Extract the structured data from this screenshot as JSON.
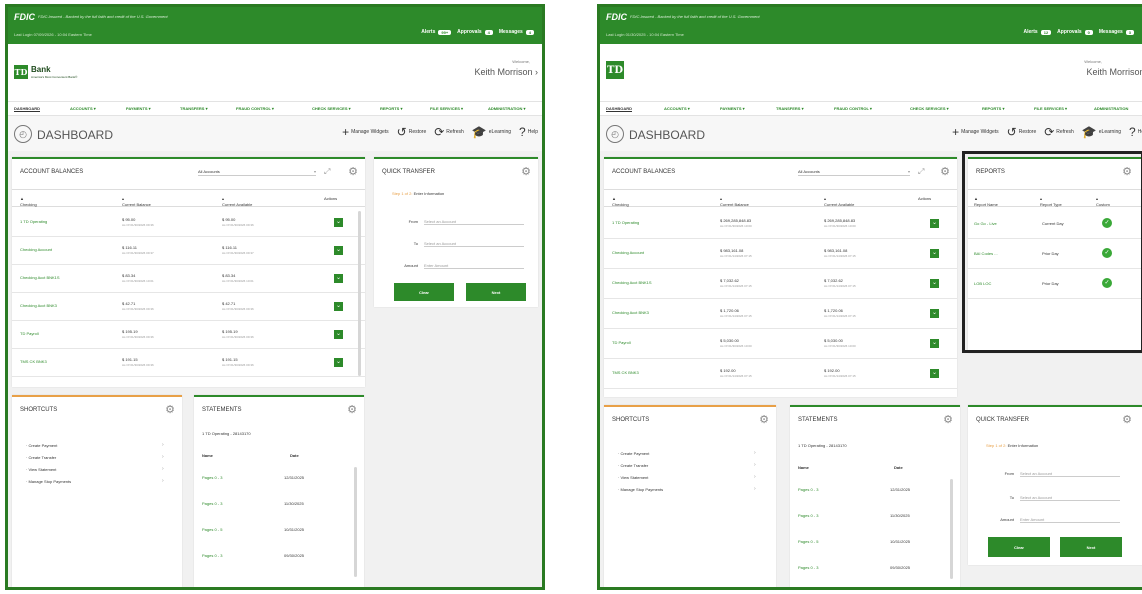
{
  "common": {
    "fdic_logo": "FDIC",
    "fdic_note": "FDIC-Insured - Backed by the full faith and credit of the U.S. Government",
    "alerts_label": "Alerts",
    "approvals_label": "Approvals",
    "messages_label": "Messages",
    "bank_logo": "TD",
    "bank_name": "Bank",
    "bank_tagline": "America's Most Convenient Bank®",
    "welcome": "Welcome,",
    "user_name": "Keith Morrison",
    "nav": [
      "DASHBOARD",
      "ACCOUNTS",
      "PAYMENTS",
      "TRANSFERS",
      "FRAUD CONTROL",
      "CHECK SERVICES",
      "REPORTS",
      "FILE SERVICES",
      "ADMINISTRATION"
    ],
    "page_title": "DASHBOARD",
    "tools": {
      "manage": "Manage Widgets",
      "restore": "Restore",
      "refresh": "Refresh",
      "elearning": "eLearning",
      "help": "Help"
    },
    "quick_transfer": {
      "title": "QUICK TRANSFER",
      "step": "Step 1 of 2:",
      "step_text": "Enter Information",
      "from_label": "From",
      "from_placeholder": "Select an Account",
      "to_label": "To",
      "to_placeholder": "Select an Account",
      "amount_label": "Amount",
      "amount_placeholder": "Enter Amount",
      "clear": "Clear",
      "next": "Next"
    },
    "shortcuts": {
      "title": "SHORTCUTS",
      "items": [
        "Create Payment",
        "Create Transfer",
        "View Statement",
        "Manage Stop Payments"
      ]
    },
    "statements": {
      "title": "STATEMENTS",
      "account": "1 TD Operating - 28143170",
      "col_name": "Name",
      "col_date": "Date",
      "rows": [
        {
          "name": "Pages 0 - 3",
          "date": "12/31/2025"
        },
        {
          "name": "Pages 0 - 3",
          "date": "11/30/2025"
        },
        {
          "name": "Pages 0 - 5",
          "date": "10/31/2025"
        },
        {
          "name": "Pages 0 - 3",
          "date": "09/30/2025"
        }
      ]
    },
    "balances_title": "ACCOUNT BALANCES",
    "balances_filter": "All Accounts",
    "col_checking": "Checking",
    "col_current": "Current Balance",
    "col_available": "Current Available",
    "col_actions": "Actions"
  },
  "screen1": {
    "last_login": "Last Login 07/09/2026 - 10:04 Eastern Time",
    "alerts_count": "99+",
    "approvals_count": "4",
    "messages_count": "4",
    "balances": [
      {
        "name": "1 TD Operating",
        "current": "$ 95.00",
        "current_asof": "As Of 01/30/2026 09:36",
        "available": "$ 95.00",
        "available_asof": "As Of 01/30/2026 09:36"
      },
      {
        "name": "Checking Account",
        "current": "$ 116.11",
        "current_asof": "As Of 01/30/2026 09:37",
        "available": "$ 116.11",
        "available_asof": "As Of 01/30/2026 09:37"
      },
      {
        "name": "Checking Acct BNK1S",
        "current": "$ 83.34",
        "current_asof": "As Of 01/30/2026 10:01",
        "available": "$ 83.34",
        "available_asof": "As Of 01/30/2026 10:01"
      },
      {
        "name": "Checking Acct BNK3",
        "current": "$ 42.71",
        "current_asof": "As Of 01/30/2026 09:36",
        "available": "$ 42.71",
        "available_asof": "As Of 01/30/2026 09:36"
      },
      {
        "name": "TD Payroll",
        "current": "$ 195.19",
        "current_asof": "As Of 01/30/2026 09:36",
        "available": "$ 195.19",
        "available_asof": "As Of 01/30/2026 09:36"
      },
      {
        "name": "TMS CK BNK3",
        "current": "$ 191.15",
        "current_asof": "As Of 01/30/2026 09:36",
        "available": "$ 191.15",
        "available_asof": "As Of 01/30/2026 09:36"
      }
    ]
  },
  "screen2": {
    "last_login": "Last Login 01/30/2025 - 10:04 Eastern Time",
    "alerts_count": "12",
    "approvals_count": "0",
    "messages_count": "3",
    "balances": [
      {
        "name": "1 TD Operating",
        "current": "$ 269,285,848.83",
        "current_asof": "As Of 01/30/2026 10:00",
        "available": "$ 269,285,848.83",
        "available_asof": "As Of 01/30/2026 10:00"
      },
      {
        "name": "Checking Account",
        "current": "$ 983,161.08",
        "current_asof": "As Of 01/14/2026 07:15",
        "available": "$ 983,161.08",
        "available_asof": "As Of 01/14/2026 07:15"
      },
      {
        "name": "Checking Acct BNK1S",
        "current": "$ 7,032.62",
        "current_asof": "As Of 01/14/2026 07:15",
        "available": "$ 7,032.62",
        "available_asof": "As Of 01/14/2026 07:15"
      },
      {
        "name": "Checking Acct BNK3",
        "current": "$ 1,720.06",
        "current_asof": "As Of 01/14/2026 07:15",
        "available": "$ 1,720.06",
        "available_asof": "As Of 01/14/2026 07:15"
      },
      {
        "name": "TD Payroll",
        "current": "$ 5,030.00",
        "current_asof": "As Of 01/30/2026 10:00",
        "available": "$ 5,030.00",
        "available_asof": "As Of 01/30/2026 10:00"
      },
      {
        "name": "TMS CK BNK3",
        "current": "$ 192.00",
        "current_asof": "As Of 01/14/2026 07:15",
        "available": "$ 192.00",
        "available_asof": "As Of 01/14/2026 07:15"
      }
    ],
    "reports": {
      "title": "REPORTS",
      "col_name": "Report Name",
      "col_type": "Report Type",
      "col_custom": "Custom",
      "rows": [
        {
          "name": "Go Go - Live",
          "type": "Current Day"
        },
        {
          "name": "BAI Codes ...",
          "type": "Prior Day"
        },
        {
          "name": "LOB LOC",
          "type": "Prior Day"
        }
      ]
    }
  },
  "colors": {
    "brand_green": "#2d8a2a",
    "accent_orange": "#e8a047"
  }
}
